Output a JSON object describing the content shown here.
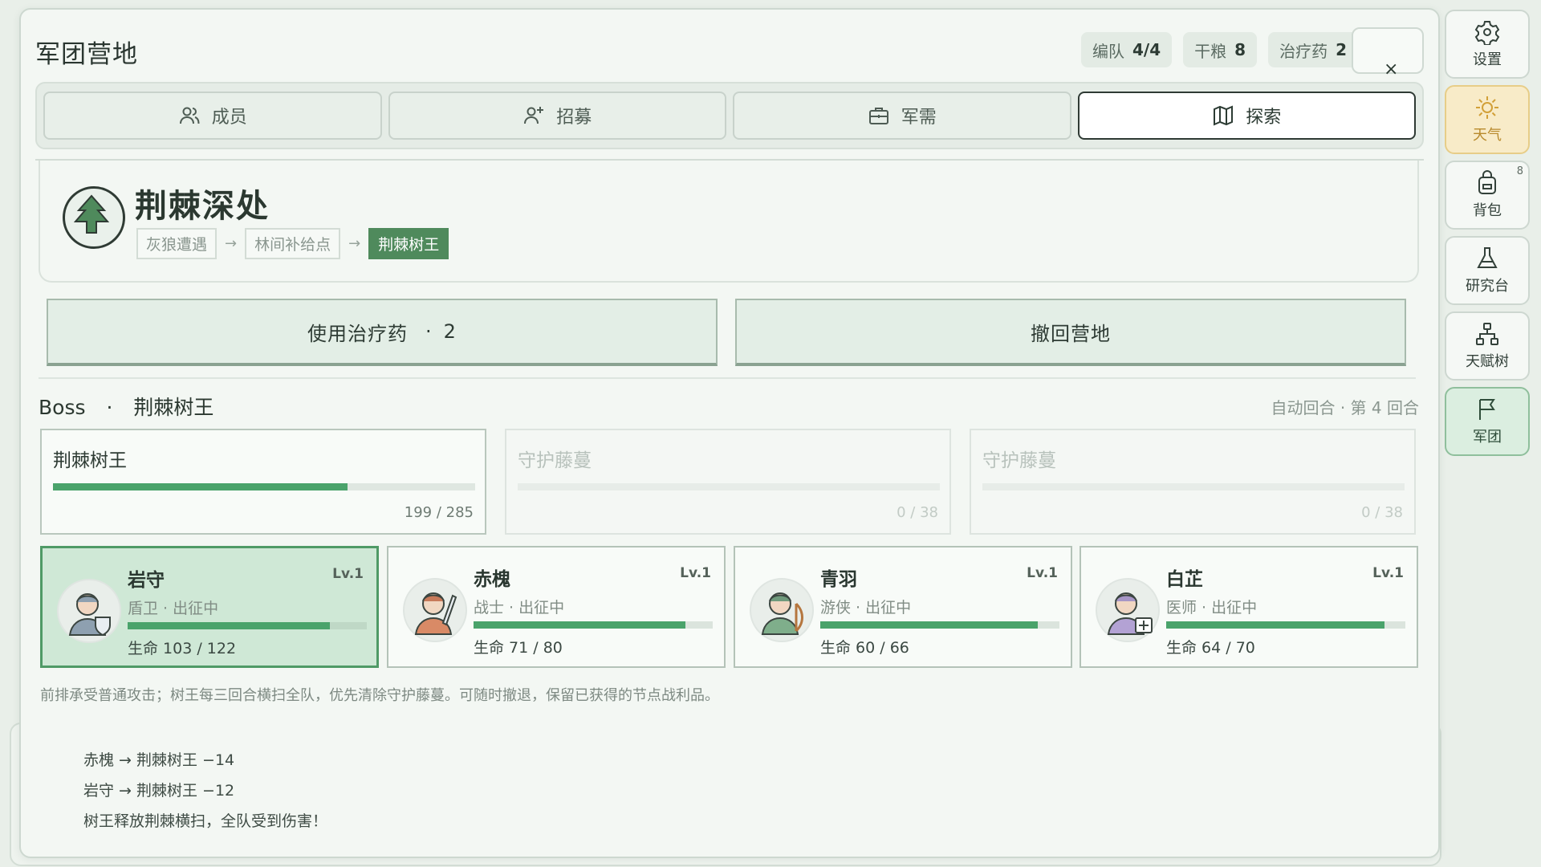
{
  "header": {
    "title": "军团营地",
    "stats": [
      {
        "label": "编队",
        "value": "4/4"
      },
      {
        "label": "干粮",
        "value": "8"
      },
      {
        "label": "治疗药",
        "value": "2"
      }
    ],
    "close_glyph": "×"
  },
  "tabs": [
    {
      "label": "成员",
      "icon": "users-icon",
      "active": false
    },
    {
      "label": "招募",
      "icon": "user-plus-icon",
      "active": false
    },
    {
      "label": "军需",
      "icon": "briefcase-icon",
      "active": false
    },
    {
      "label": "探索",
      "icon": "map-icon",
      "active": true
    }
  ],
  "zone": {
    "name": "荆棘深处",
    "emblem_icon": "tree-icon",
    "path": [
      "灰狼遭遇",
      "林间补给点",
      "荆棘树王"
    ],
    "arrow": "→",
    "current_index": 2
  },
  "actions": {
    "heal_label": "使用治疗药",
    "heal_sep": "·",
    "heal_count": "2",
    "retreat_label": "撤回营地"
  },
  "battle": {
    "boss_prefix": "Boss",
    "boss_sep": "·",
    "boss_name": "荆棘树王",
    "meta": "自动回合 · 第 4 回合"
  },
  "enemies": [
    {
      "name": "荆棘树王",
      "hp": "199 / 285",
      "hp_fraction": 0.698,
      "alive": true
    },
    {
      "name": "守护藤蔓",
      "hp": "0 / 38",
      "hp_fraction": 0.0,
      "alive": false
    },
    {
      "name": "守护藤蔓",
      "hp": "0 / 38",
      "hp_fraction": 0.0,
      "alive": false
    }
  ],
  "heroes": [
    {
      "name": "岩守",
      "level": "Lv.1",
      "role": "盾卫 · 出征中",
      "hp": "生命 103 / 122",
      "hp_fraction": 0.844,
      "active": true,
      "icon": "shield-icon"
    },
    {
      "name": "赤槐",
      "level": "Lv.1",
      "role": "战士 · 出征中",
      "hp": "生命 71 / 80",
      "hp_fraction": 0.8875,
      "active": false,
      "icon": "sword-icon"
    },
    {
      "name": "青羽",
      "level": "Lv.1",
      "role": "游侠 · 出征中",
      "hp": "生命 60 / 66",
      "hp_fraction": 0.909,
      "active": false,
      "icon": "bow-icon"
    },
    {
      "name": "白芷",
      "level": "Lv.1",
      "role": "医师 · 出征中",
      "hp": "生命 64 / 70",
      "hp_fraction": 0.914,
      "active": false,
      "icon": "medkit-icon"
    }
  ],
  "hint": "前排承受普通攻击；树王每三回合横扫全队，优先清除守护藤蔓。可随时撤退，保留已获得的节点战利品。",
  "log": [
    "赤槐 → 荆棘树王 −14",
    "岩守 → 荆棘树王 −12",
    "树王释放荆棘横扫，全队受到伤害！"
  ],
  "rail": [
    {
      "label": "设置",
      "icon": "gear-icon"
    },
    {
      "label": "天气",
      "icon": "sun-icon"
    },
    {
      "label": "背包",
      "icon": "backpack-icon",
      "badge": "8"
    },
    {
      "label": "研究台",
      "icon": "flask-icon"
    },
    {
      "label": "天赋树",
      "icon": "talent-tree-icon"
    },
    {
      "label": "军团",
      "icon": "flag-icon"
    }
  ],
  "colors": {
    "accent_green": "#4f8a5c",
    "hp_green": "#4aa36b",
    "active_card": "#cfe8d6",
    "weather_bg": "#f8ebc8"
  }
}
